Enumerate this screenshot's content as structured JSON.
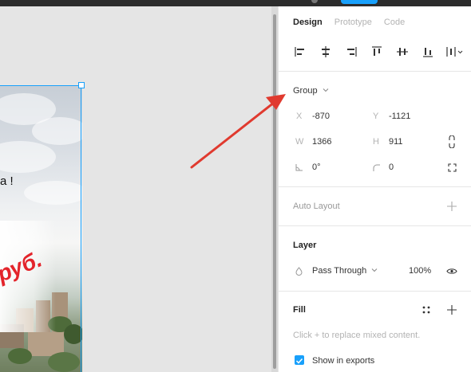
{
  "canvas": {
    "frame_text": "а !",
    "frame_price": "руб."
  },
  "panel": {
    "tabs": [
      "Design",
      "Prototype",
      "Code"
    ],
    "group_label": "Group",
    "x_label": "X",
    "x_value": "-870",
    "y_label": "Y",
    "y_value": "-1121",
    "w_label": "W",
    "w_value": "1366",
    "h_label": "H",
    "h_value": "911",
    "rotation_value": "0°",
    "radius_value": "0",
    "auto_layout_label": "Auto Layout",
    "layer_label": "Layer",
    "blend_mode": "Pass Through",
    "opacity": "100%",
    "fill_label": "Fill",
    "fill_hint": "Click + to replace mixed content.",
    "show_in_exports": "Show in exports"
  },
  "colors": {
    "accent": "#18a0fb",
    "annotation_arrow": "#e03a2f",
    "price_text": "#e3242b"
  }
}
